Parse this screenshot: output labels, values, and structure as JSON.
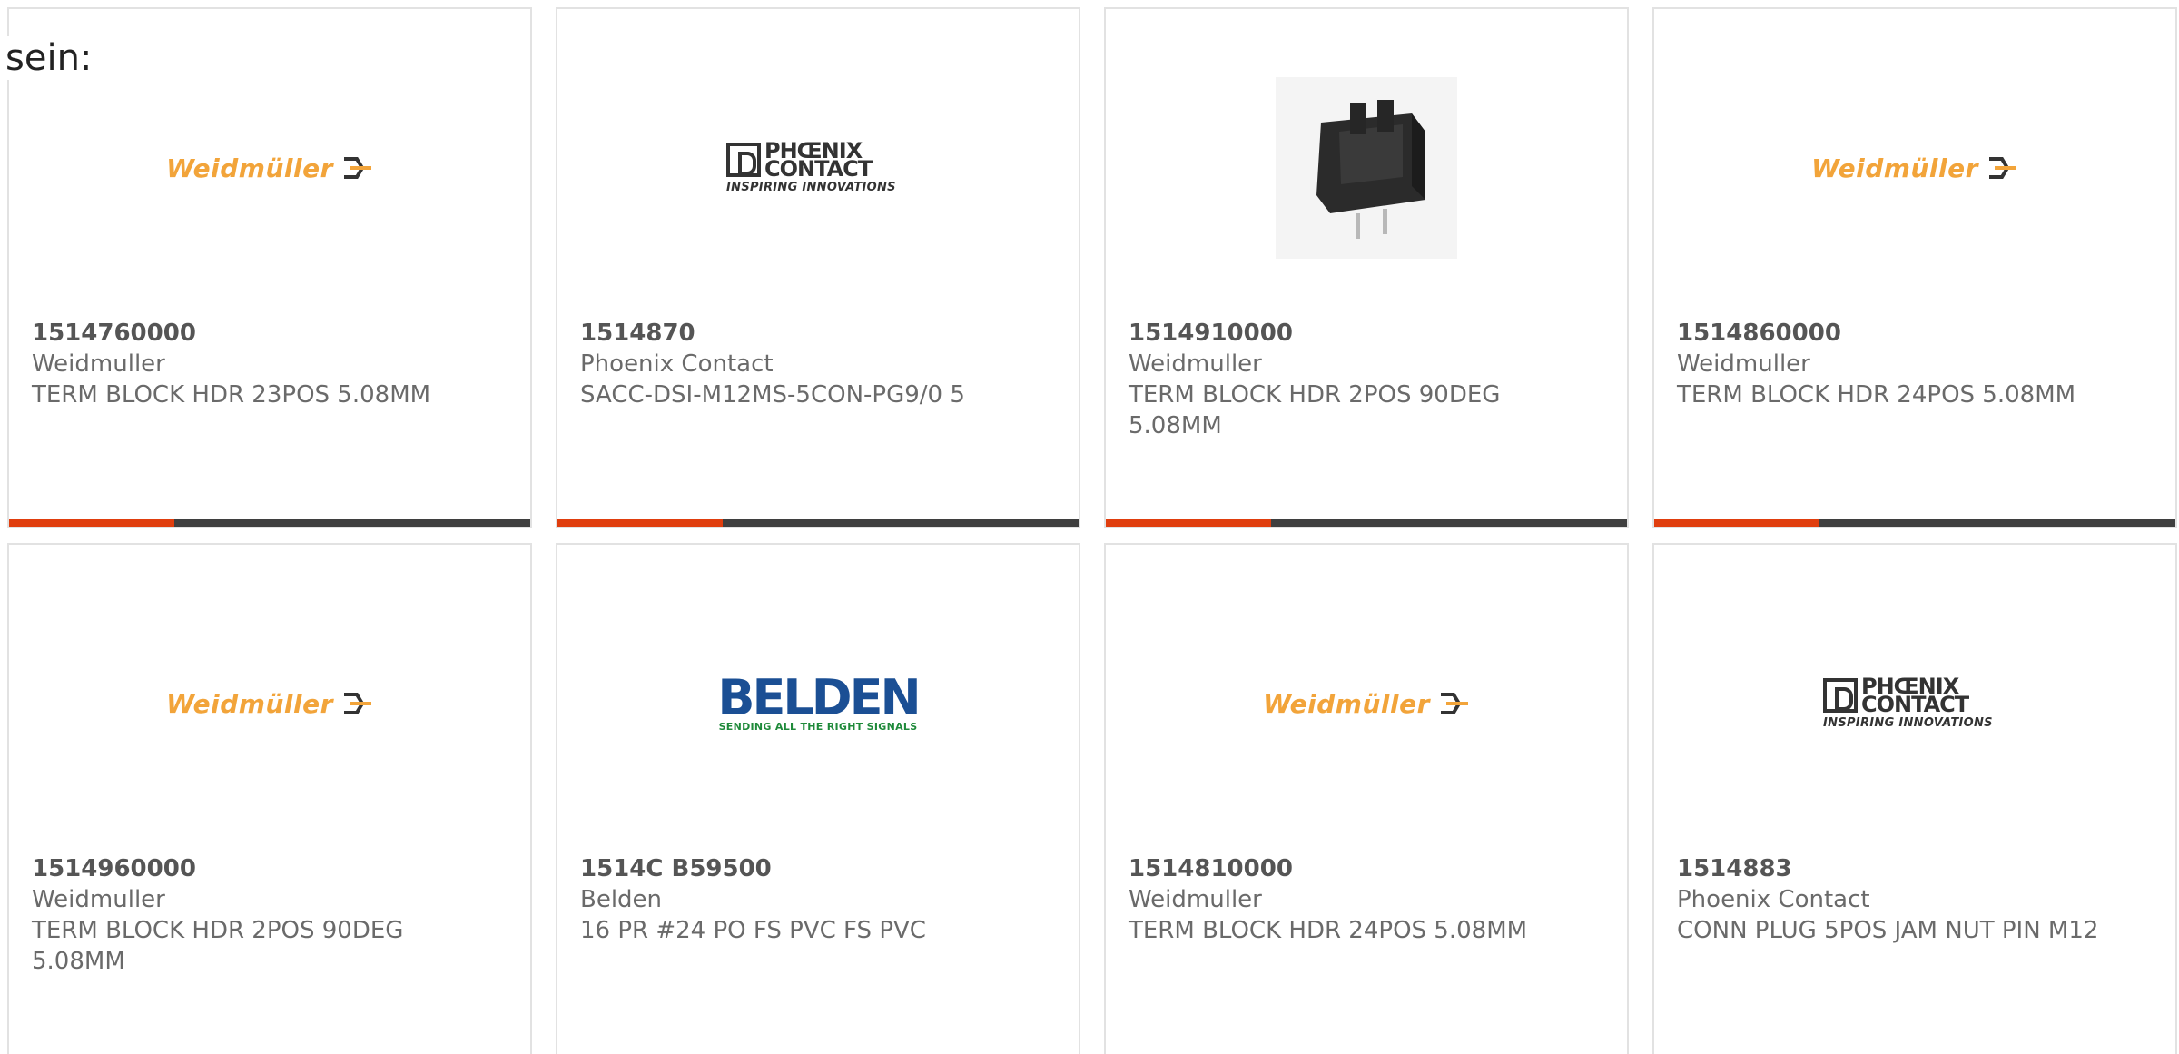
{
  "intro_text": "sein:",
  "colors": {
    "accent": "#e03e0e",
    "bar": "#3f3f3f",
    "border": "#e2e2e2"
  },
  "products": [
    {
      "part": "1514760000",
      "mfr": "Weidmuller",
      "desc": "TERM BLOCK HDR 23POS 5.08MM",
      "logo": "Weidmüller"
    },
    {
      "part": "1514870",
      "mfr": "Phoenix Contact",
      "desc": "SACC-DSI-M12MS-5CON-PG9/0 5",
      "logo": "PHŒNIX CONTACT",
      "logo_tag": "INSPIRING INNOVATIONS"
    },
    {
      "part": "1514910000",
      "mfr": "Weidmuller",
      "desc": "TERM BLOCK HDR 2POS 90DEG 5.08MM",
      "logo": "connector-photo"
    },
    {
      "part": "1514860000",
      "mfr": "Weidmuller",
      "desc": "TERM BLOCK HDR 24POS 5.08MM",
      "logo": "Weidmüller"
    },
    {
      "part": "1514960000",
      "mfr": "Weidmuller",
      "desc": "TERM BLOCK HDR 2POS 90DEG 5.08MM",
      "logo": "Weidmüller"
    },
    {
      "part": "1514C B59500",
      "mfr": "Belden",
      "desc": "16 PR #24 PO FS PVC FS PVC",
      "logo": "BELDEN",
      "logo_tag": "SENDING ALL THE RIGHT SIGNALS"
    },
    {
      "part": "1514810000",
      "mfr": "Weidmuller",
      "desc": "TERM BLOCK HDR 24POS 5.08MM",
      "logo": "Weidmüller"
    },
    {
      "part": "1514883",
      "mfr": "Phoenix Contact",
      "desc": "CONN PLUG 5POS JAM NUT PIN M12",
      "logo": "PHŒNIX CONTACT",
      "logo_tag": "INSPIRING INNOVATIONS"
    }
  ]
}
